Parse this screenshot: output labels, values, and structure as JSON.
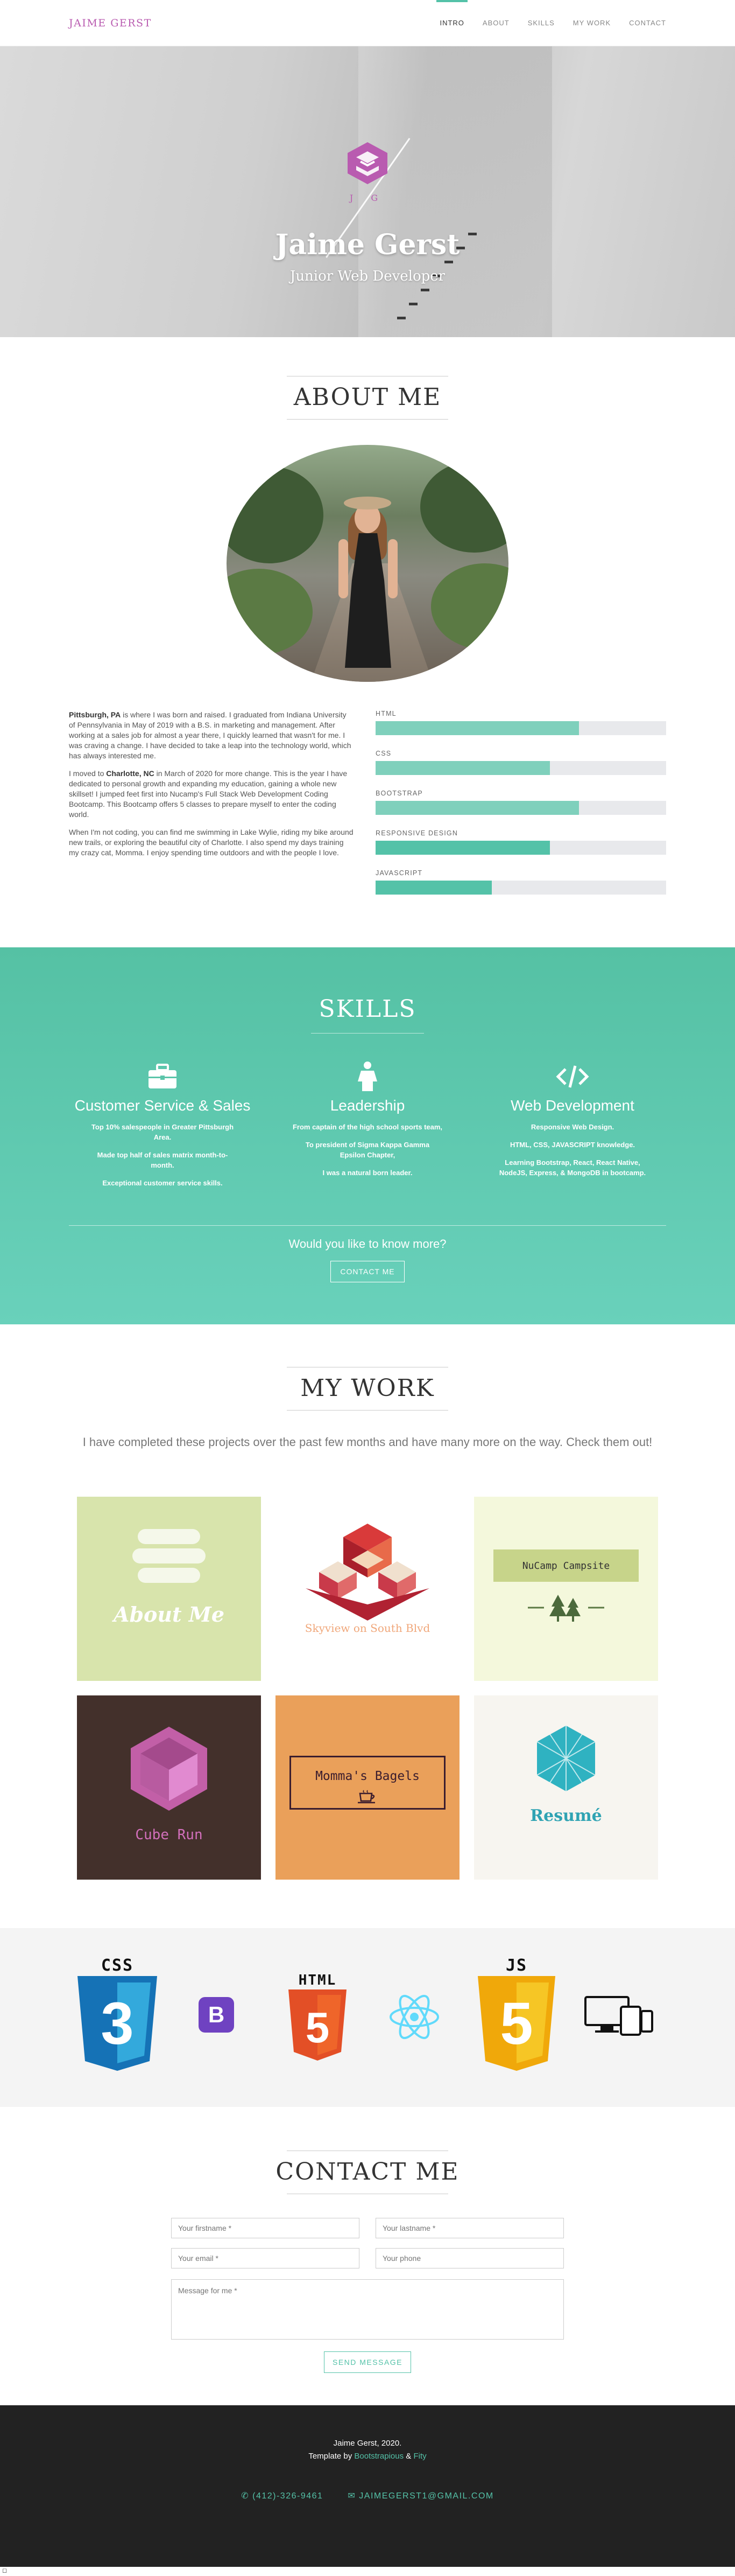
{
  "nav": {
    "brand": "JAIME GERST",
    "links": [
      "INTRO",
      "ABOUT",
      "SKILLS",
      "MY WORK",
      "CONTACT"
    ]
  },
  "hero": {
    "logo_text": "J G",
    "name": "Jaime Gerst",
    "subtitle": "Junior Web Developer"
  },
  "about": {
    "title": "ABOUT ME",
    "p1_bold": "Pittsburgh, PA",
    "p1": " is where I was born and raised. I graduated from Indiana University of Pennsylvania in May of 2019 with a B.S. in marketing and management. After working at a sales job for almost a year there, I quickly learned that wasn't for me. I was craving a change. I have decided to take a leap into the technology world, which has always interested me.",
    "p2_pre": "I moved to ",
    "p2_bold": "Charlotte, NC",
    "p2": " in March of 2020 for more change. This is the year I have dedicated to personal growth and expanding my education, gaining a whole new skillset! I jumped feet first into Nucamp's Full Stack Web Development Coding Bootcamp. This Bootcamp offers 5 classes to prepare myself to enter the coding world.",
    "p3": "When I'm not coding, you can find me swimming in Lake Wylie, riding my bike around new trails, or exploring the beautiful city of Charlotte. I also spend my days training my crazy cat, Momma. I enjoy spending time outdoors and with the people I love.",
    "skills": [
      {
        "label": "HTML",
        "level": 0.7
      },
      {
        "label": "CSS",
        "level": 0.6
      },
      {
        "label": "BOOTSTRAP",
        "level": 0.7
      },
      {
        "label": "RESPONSIVE DESIGN",
        "level": 0.6
      },
      {
        "label": "JAVASCRIPT",
        "level": 0.4
      }
    ]
  },
  "skills": {
    "title": "SKILLS",
    "columns": [
      {
        "title": "Customer Service & Sales",
        "icon": "briefcase-icon",
        "items": [
          "Top 10% salespeople in Greater Pittsburgh Area.",
          "Made top half of sales matrix month-to-month.",
          "Exceptional customer service skills."
        ]
      },
      {
        "title": "Leadership",
        "icon": "person-icon",
        "items": [
          "From captain of the high school sports team,",
          "To president of Sigma Kappa Gamma Epsilon Chapter,",
          "I was a natural born leader."
        ]
      },
      {
        "title": "Web Development",
        "icon": "code-icon",
        "items": [
          "Responsive Web Design.",
          "HTML, CSS, JAVASCRIPT knowledge.",
          "Learning Bootstrap, React, React Native, NodeJS, Express, & MongoDB in bootcamp."
        ]
      }
    ],
    "cta_text": "Would you like to know more?",
    "cta_button": "CONTACT ME"
  },
  "work": {
    "title": "MY WORK",
    "intro": "I have completed these projects over the past few months and have many more on the way. Check them out!",
    "projects": [
      {
        "label": "About Me",
        "bg": "#d8e4ac"
      },
      {
        "label": "Skyview on South Blvd",
        "bg": "#ffffff"
      },
      {
        "label": "NuCamp Campsite",
        "bg": "#f4f8dc"
      },
      {
        "label": "Cube Run",
        "bg": "#43302b"
      },
      {
        "label": "Momma's Bagels",
        "bg": "#eaa05a"
      },
      {
        "label": "Resumé",
        "bg": "#f7f5f0"
      }
    ]
  },
  "tech": {
    "css": "CSS",
    "css_num": "3",
    "bootstrap": "B",
    "html": "HTML",
    "html_num": "5",
    "js": "JS",
    "js_num": "5"
  },
  "contact": {
    "title": "CONTACT ME",
    "firstname_ph": "Your firstname *",
    "lastname_ph": "Your lastname *",
    "email_ph": "Your email *",
    "phone_ph": "Your phone",
    "message_ph": "Message for me *",
    "send": "SEND MESSAGE"
  },
  "footer": {
    "line1": "Jaime Gerst, 2020.",
    "template_pre": "Template by ",
    "template_link1": "Bootstrapious",
    "template_amp": " & ",
    "template_link2": "Fity",
    "phone": "(412)-326-9461",
    "email": "JAIMEGERST1@GMAIL.COM"
  },
  "colors": {
    "accent": "#54c2a8",
    "brand": "#b95bb0",
    "footer_bg": "#222222"
  },
  "mini_label": "◻"
}
